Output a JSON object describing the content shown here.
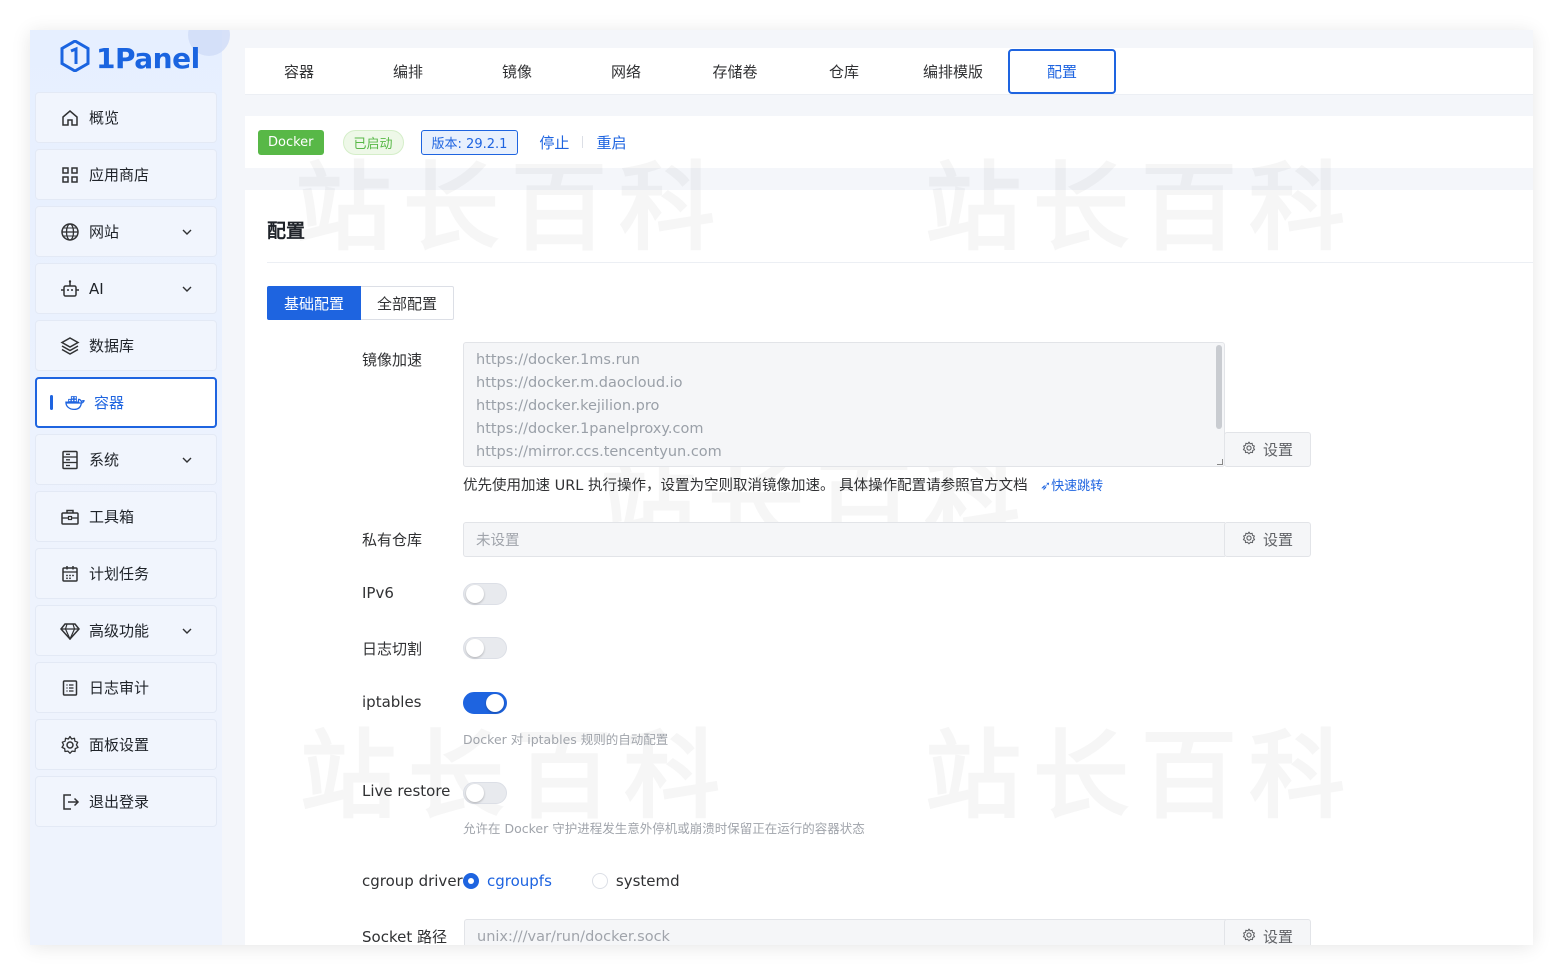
{
  "brand": {
    "logo_text": "1Panel",
    "accent": "#1e64e0"
  },
  "sidebar": {
    "items": [
      {
        "label": "概览",
        "icon": "home-icon",
        "expandable": false
      },
      {
        "label": "应用商店",
        "icon": "grid-icon",
        "expandable": false
      },
      {
        "label": "网站",
        "icon": "globe-icon",
        "expandable": true
      },
      {
        "label": "AI",
        "icon": "robot-icon",
        "expandable": true
      },
      {
        "label": "数据库",
        "icon": "layers-icon",
        "expandable": false
      },
      {
        "label": "容器",
        "icon": "docker-icon",
        "expandable": false,
        "active": true
      },
      {
        "label": "系统",
        "icon": "server-icon",
        "expandable": true
      },
      {
        "label": "工具箱",
        "icon": "toolbox-icon",
        "expandable": false
      },
      {
        "label": "计划任务",
        "icon": "calendar-icon",
        "expandable": false
      },
      {
        "label": "高级功能",
        "icon": "diamond-icon",
        "expandable": true
      },
      {
        "label": "日志审计",
        "icon": "log-icon",
        "expandable": false
      },
      {
        "label": "面板设置",
        "icon": "gear-icon",
        "expandable": false
      },
      {
        "label": "退出登录",
        "icon": "logout-icon",
        "expandable": false
      }
    ]
  },
  "tabs": [
    {
      "label": "容器"
    },
    {
      "label": "编排"
    },
    {
      "label": "镜像"
    },
    {
      "label": "网络"
    },
    {
      "label": "存储卷"
    },
    {
      "label": "仓库"
    },
    {
      "label": "编排模版"
    },
    {
      "label": "配置",
      "active": true
    }
  ],
  "status": {
    "service": "Docker",
    "state": "已启动",
    "version": "版本: 29.2.1",
    "stop": "停止",
    "restart": "重启"
  },
  "panel": {
    "title": "配置",
    "segments": {
      "basic": "基础配置",
      "all": "全部配置"
    },
    "mirror": {
      "label": "镜像加速",
      "lines": [
        "https://docker.1ms.run",
        "https://docker.m.daocloud.io",
        "https://docker.kejilion.pro",
        "https://docker.1panelproxy.com",
        "https://mirror.ccs.tencentyun.com"
      ],
      "help": "优先使用加速 URL 执行操作，设置为空则取消镜像加速。 具体操作配置请参照官方文档",
      "help_link": "快速跳转"
    },
    "set_label": "设置",
    "registry": {
      "label": "私有仓库",
      "placeholder": "未设置"
    },
    "ipv6": {
      "label": "IPv6",
      "on": false
    },
    "log_rotate": {
      "label": "日志切割",
      "on": false
    },
    "iptables": {
      "label": "iptables",
      "on": true,
      "help": "Docker 对 iptables 规则的自动配置"
    },
    "live_restore": {
      "label": "Live restore",
      "on": false,
      "help": "允许在 Docker 守护进程发生意外停机或崩溃时保留正在运行的容器状态"
    },
    "cgroup": {
      "label": "cgroup driver",
      "options": [
        "cgroupfs",
        "systemd"
      ],
      "selected": "cgroupfs"
    },
    "socket": {
      "label": "Socket 路径",
      "value": "unix:///var/run/docker.sock"
    }
  }
}
